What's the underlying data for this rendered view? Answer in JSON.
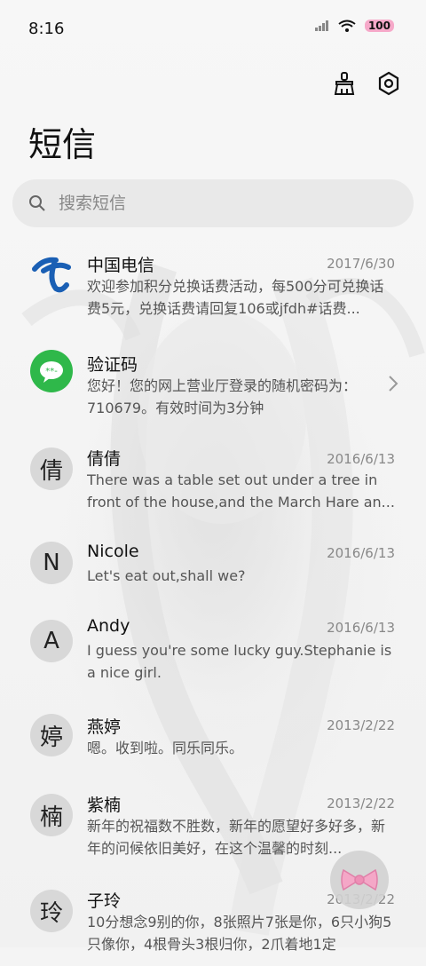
{
  "status_bar": {
    "time": "8:16",
    "battery": "100"
  },
  "toolbar": {
    "clean_icon": "broom-icon",
    "settings_icon": "gear-icon"
  },
  "page_title": "短信",
  "search": {
    "placeholder": "搜索短信",
    "icon": "search-icon"
  },
  "conversations": [
    {
      "name": "中国电信",
      "date": "2017/6/30",
      "preview": "欢迎参加积分兑换话费活动，每500分可兑换话费5元，兑换话费请回复106或jfdh#话费...",
      "avatar": "china-telecom-logo"
    },
    {
      "name": "验证码",
      "date": "",
      "preview": "您好！您的网上营业厅登录的随机密码为：710679。有效时间为3分钟",
      "avatar": "message-bubble-icon"
    },
    {
      "name": "倩倩",
      "date": "2016/6/13",
      "preview": "There was a table set out under a tree in front of the house,and the March Hare an...",
      "avatar": "倩"
    },
    {
      "name": "Nicole",
      "date": "2016/6/13",
      "preview": "Let's eat out,shall we?",
      "avatar": "N"
    },
    {
      "name": "Andy",
      "date": "2016/6/13",
      "preview": "I guess you're some lucky guy.Stephanie is a nice girl.",
      "avatar": "A"
    },
    {
      "name": "燕婷",
      "date": "2013/2/22",
      "preview": "嗯。收到啦。同乐同乐。",
      "avatar": "婷"
    },
    {
      "name": "紫楠",
      "date": "2013/2/22",
      "preview": "新年的祝福数不胜数，新年的愿望好多好多，新年的问候依旧美好，在这个温馨的时刻...",
      "avatar": "楠"
    },
    {
      "name": "子玲",
      "date": "2013/2/22",
      "preview": "10分想念9别的你，8张照片7张是你，6只小狗5只像你，4根骨头3根归你，2爪着地1定",
      "avatar": "玲"
    }
  ]
}
